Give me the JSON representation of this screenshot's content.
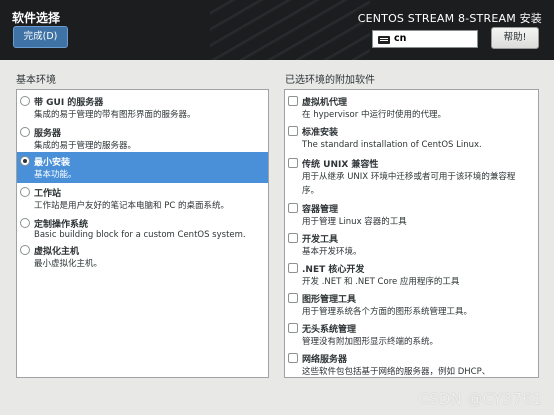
{
  "header": {
    "title": "软件选择",
    "done_label": "完成(D)",
    "product": "CENTOS STREAM 8-STREAM 安装",
    "keyboard_layout": "cn",
    "help_label": "帮助!"
  },
  "base_env": {
    "heading": "基本环境",
    "items": [
      {
        "name": "带 GUI 的服务器",
        "desc": "集成的易于管理的带有图形界面的服务器。"
      },
      {
        "name": "服务器",
        "desc": "集成的易于管理的服务器。"
      },
      {
        "name": "最小安装",
        "desc": "基本功能。"
      },
      {
        "name": "工作站",
        "desc": "工作站是用户友好的笔记本电脑和 PC 的桌面系统。"
      },
      {
        "name": "定制操作系统",
        "desc": "Basic building block for a custom CentOS system."
      },
      {
        "name": "虚拟化主机",
        "desc": "最小虚拟化主机。"
      }
    ]
  },
  "addons": {
    "heading": "已选环境的附加软件",
    "items": [
      {
        "name": "虚拟机代理",
        "desc": "在 hypervisor 中运行时使用的代理。"
      },
      {
        "name": "标准安装",
        "desc": "The standard installation of CentOS Linux."
      },
      {
        "name": "传统 UNIX 兼容性",
        "desc": "用于从继承 UNIX 环境中迁移或者可用于该环境的兼容程序。"
      },
      {
        "name": "容器管理",
        "desc": "用于管理 Linux 容器的工具"
      },
      {
        "name": "开发工具",
        "desc": "基本开发环境。"
      },
      {
        "name": ".NET 核心开发",
        "desc": "开发 .NET 和 .NET Core 应用程序的工具"
      },
      {
        "name": "图形管理工具",
        "desc": "用于管理系统各个方面的图形系统管理工具。"
      },
      {
        "name": "无头系统管理",
        "desc": "管理没有附加图形显示终端的系统。"
      },
      {
        "name": "网络服务器",
        "desc": "这些软件包包括基于网络的服务器，例如 DHCP、"
      }
    ]
  },
  "watermark": "CSDN @CY3761"
}
